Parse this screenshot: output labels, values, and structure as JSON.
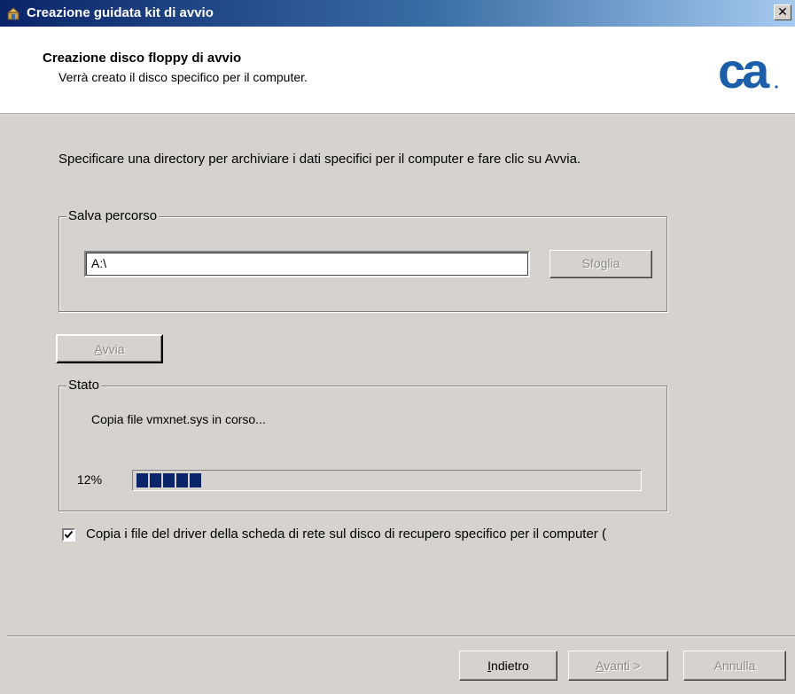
{
  "window": {
    "title": "Creazione guidata kit di avvio",
    "close_glyph": "✕"
  },
  "header": {
    "title": "Creazione disco floppy di avvio",
    "subtitle": "Verrà creato il disco specifico per il computer.",
    "logo_text": "ca",
    "logo_color": "#1b5fab"
  },
  "instruction": "Specificare una directory per archiviare i dati specifici per il computer e fare clic su Avvia.",
  "save_path": {
    "legend": "Salva percorso",
    "value": "A:\\",
    "browse_label": "Sfoglia"
  },
  "start_button": {
    "first": "A",
    "rest": "vvia"
  },
  "status": {
    "legend": "Stato",
    "message": "Copia file vmxnet.sys in corso...",
    "percent_label": "12%",
    "progress_fraction": 0.12,
    "progress_color": "#0a246a"
  },
  "option": {
    "checked": true,
    "label": "Copia i file del driver della scheda di rete sul disco di recupero specifico per il computer ("
  },
  "footer": {
    "back": {
      "pre": "",
      "key": "I",
      "rest": "ndietro"
    },
    "next": {
      "pre": "",
      "key": "A",
      "rest": "vanti >"
    },
    "cancel": "Annulla"
  }
}
